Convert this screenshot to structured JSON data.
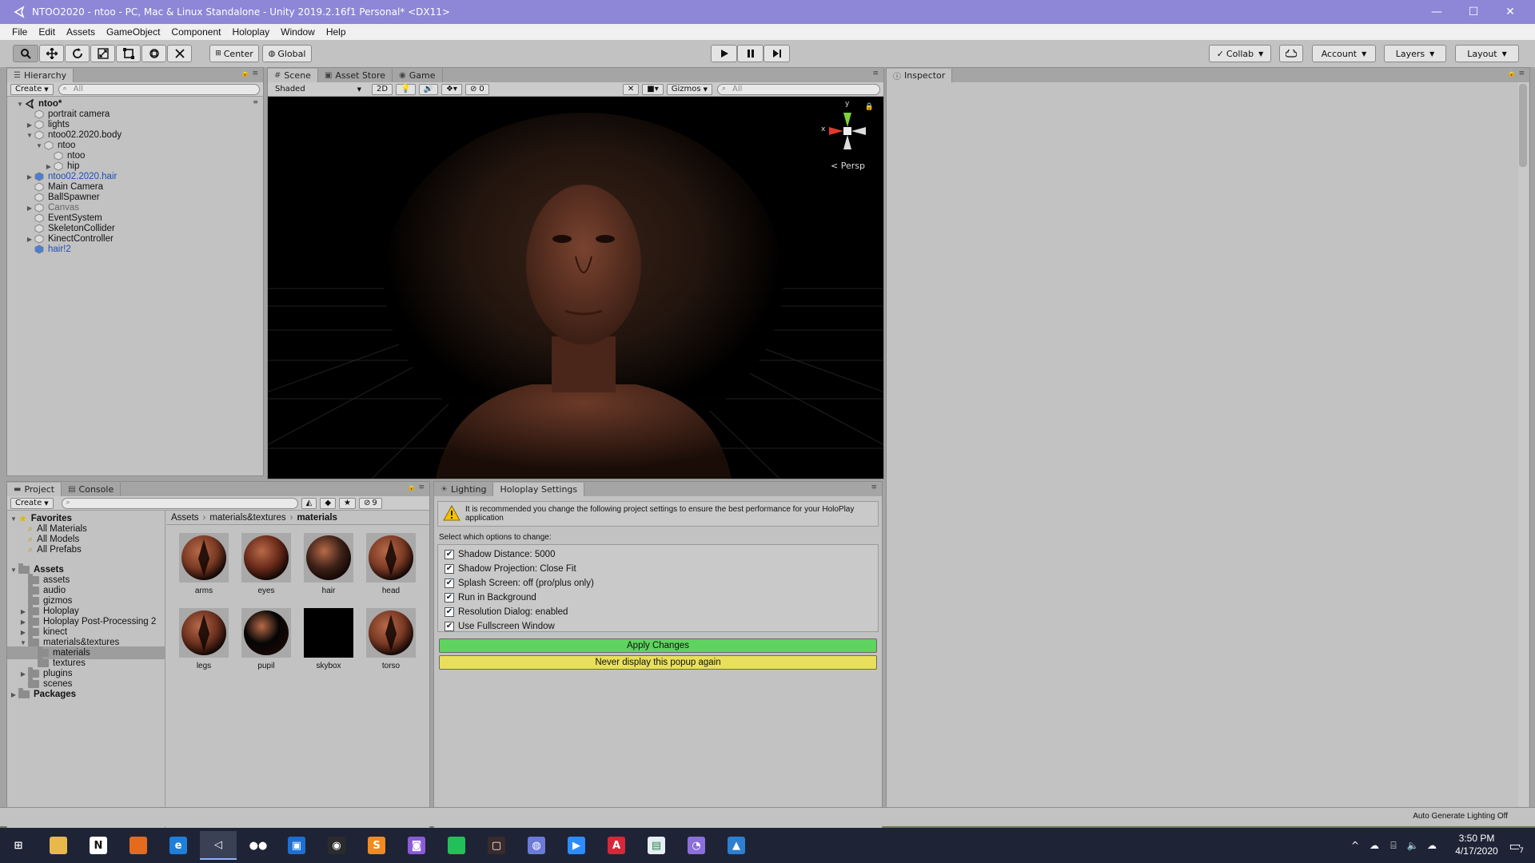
{
  "window": {
    "title": "NTOO2020 - ntoo - PC, Mac & Linux Standalone - Unity 2019.2.16f1 Personal* <DX11>",
    "controls": [
      "—",
      "☐",
      "✕"
    ]
  },
  "menu": [
    "File",
    "Edit",
    "Assets",
    "GameObject",
    "Component",
    "Holoplay",
    "Window",
    "Help"
  ],
  "toolbar": {
    "pivot_label": "Center",
    "space_label": "Global",
    "collab_label": "Collab",
    "account_label": "Account",
    "layers_label": "Layers",
    "layout_label": "Layout"
  },
  "hierarchy": {
    "tab_label": "Hierarchy",
    "create_label": "Create",
    "search_placeholder": "All",
    "items": [
      {
        "label": "ntoo*",
        "depth": 0,
        "arrow": "open",
        "style": "bold",
        "icon": "unity-scene-icon"
      },
      {
        "label": "portrait camera",
        "depth": 1,
        "arrow": "none",
        "style": "normal",
        "icon": "gameobject-icon"
      },
      {
        "label": "lights",
        "depth": 1,
        "arrow": "closed",
        "style": "normal",
        "icon": "gameobject-icon"
      },
      {
        "label": "ntoo02.2020.body",
        "depth": 1,
        "arrow": "open",
        "style": "normal",
        "icon": "gameobject-icon"
      },
      {
        "label": "ntoo",
        "depth": 2,
        "arrow": "open",
        "style": "normal",
        "icon": "gameobject-icon"
      },
      {
        "label": "ntoo",
        "depth": 3,
        "arrow": "none",
        "style": "normal",
        "icon": "gameobject-icon"
      },
      {
        "label": "hip",
        "depth": 3,
        "arrow": "closed",
        "style": "normal",
        "icon": "gameobject-icon"
      },
      {
        "label": "ntoo02.2020.hair",
        "depth": 1,
        "arrow": "closed",
        "style": "blue",
        "icon": "prefab-icon"
      },
      {
        "label": "Main Camera",
        "depth": 1,
        "arrow": "none",
        "style": "normal",
        "icon": "gameobject-icon"
      },
      {
        "label": "BallSpawner",
        "depth": 1,
        "arrow": "none",
        "style": "normal",
        "icon": "gameobject-icon"
      },
      {
        "label": "Canvas",
        "depth": 1,
        "arrow": "closed",
        "style": "dim",
        "icon": "gameobject-icon"
      },
      {
        "label": "EventSystem",
        "depth": 1,
        "arrow": "none",
        "style": "normal",
        "icon": "gameobject-icon"
      },
      {
        "label": "SkeletonCollider",
        "depth": 1,
        "arrow": "none",
        "style": "normal",
        "icon": "gameobject-icon"
      },
      {
        "label": "KinectController",
        "depth": 1,
        "arrow": "closed",
        "style": "normal",
        "icon": "gameobject-icon"
      },
      {
        "label": "hair!2",
        "depth": 1,
        "arrow": "none",
        "style": "blue",
        "icon": "prefab-icon"
      }
    ]
  },
  "scene": {
    "tabs": [
      "Scene",
      "Asset Store",
      "Game"
    ],
    "shading_mode": "Shaded",
    "mode_2d_label": "2D",
    "hidden_count": "0",
    "gizmos_label": "Gizmos",
    "search_placeholder": "All",
    "persp_label": "Persp",
    "axis_x": "x",
    "axis_y": "y"
  },
  "inspector": {
    "tab_label": "Inspector"
  },
  "project": {
    "tabs": [
      "Project",
      "Console"
    ],
    "create_label": "Create",
    "hidden_count": "9",
    "favorites_label": "Favorites",
    "favorites": [
      "All Materials",
      "All Models",
      "All Prefabs"
    ],
    "assets_label": "Assets",
    "folders": [
      {
        "label": "assets",
        "arrow": "none",
        "depth": 1
      },
      {
        "label": "audio",
        "arrow": "none",
        "depth": 1
      },
      {
        "label": "gizmos",
        "arrow": "none",
        "depth": 1
      },
      {
        "label": "Holoplay",
        "arrow": "closed",
        "depth": 1
      },
      {
        "label": "Holoplay Post-Processing 2",
        "arrow": "closed",
        "depth": 1
      },
      {
        "label": "kinect",
        "arrow": "closed",
        "depth": 1
      },
      {
        "label": "materials&textures",
        "arrow": "open",
        "depth": 1
      },
      {
        "label": "materials",
        "arrow": "none",
        "depth": 2,
        "selected": true
      },
      {
        "label": "textures",
        "arrow": "none",
        "depth": 2
      },
      {
        "label": "plugins",
        "arrow": "closed",
        "depth": 1
      },
      {
        "label": "scenes",
        "arrow": "none",
        "depth": 1
      }
    ],
    "packages_label": "Packages",
    "breadcrumb": [
      "Assets",
      "materials&textures",
      "materials"
    ],
    "assets": [
      {
        "label": "arms",
        "color": "#7a3a24"
      },
      {
        "label": "eyes",
        "color": "#6a2a1a"
      },
      {
        "label": "hair",
        "color": "#3e2218"
      },
      {
        "label": "head",
        "color": "#7d3b25"
      },
      {
        "label": "legs",
        "color": "#6e3220"
      },
      {
        "label": "pupil",
        "color": "#050505"
      },
      {
        "label": "skybox",
        "color": "#000000"
      },
      {
        "label": "torso",
        "color": "#7a3a24"
      }
    ]
  },
  "holoplay": {
    "tabs": [
      "Lighting",
      "Holoplay Settings"
    ],
    "warning_text": "It is recommended you change the following project settings to ensure the best performance for your HoloPlay application",
    "select_label": "Select which options to change:",
    "options": [
      "Shadow Distance: 5000",
      "Shadow Projection: Close Fit",
      "Splash Screen: off (pro/plus only)",
      "Run in Background",
      "Resolution Dialog: enabled",
      "Use Fullscreen Window"
    ],
    "apply_label": "Apply Changes",
    "never_label": "Never display this popup again",
    "apply_color": "#5fd35f",
    "never_color": "#e8e05a"
  },
  "status": {
    "lighting_text": "Auto Generate Lighting Off"
  },
  "taskbar": {
    "time": "3:50 PM",
    "date": "4/17/2020",
    "notification_count": "7",
    "apps": [
      {
        "name": "windows-start-icon",
        "glyph": "⊞",
        "color": "#1e2436"
      },
      {
        "name": "file-explorer-icon",
        "glyph": "",
        "color": "#e8b84a"
      },
      {
        "name": "notion-icon",
        "glyph": "N",
        "color": "#ffffff"
      },
      {
        "name": "firefox-icon",
        "glyph": "",
        "color": "#e66a1e"
      },
      {
        "name": "edge-icon",
        "glyph": "e",
        "color": "#1f7fd8"
      },
      {
        "name": "unity-icon",
        "glyph": "◁",
        "color": "#3a4155"
      },
      {
        "name": "media-icon",
        "glyph": "●●",
        "color": "#1e2436"
      },
      {
        "name": "store-icon",
        "glyph": "▣",
        "color": "#1e6fd0"
      },
      {
        "name": "obs-icon",
        "glyph": "◉",
        "color": "#2b2b2b"
      },
      {
        "name": "sublime-icon",
        "glyph": "S",
        "color": "#f28a1e"
      },
      {
        "name": "twitch-icon",
        "glyph": "◙",
        "color": "#8c5ad8"
      },
      {
        "name": "pycharm-icon",
        "glyph": "",
        "color": "#21c05a"
      },
      {
        "name": "xd-icon",
        "glyph": "▢",
        "color": "#3a2a2a"
      },
      {
        "name": "discord-icon",
        "glyph": "◍",
        "color": "#6a7bd6"
      },
      {
        "name": "zoom-icon",
        "glyph": "▶",
        "color": "#2d8cff"
      },
      {
        "name": "adobe-icon",
        "glyph": "A",
        "color": "#d8263a"
      },
      {
        "name": "sheets-icon",
        "glyph": "▤",
        "color": "#e7eef5"
      },
      {
        "name": "browser-icon",
        "glyph": "◔",
        "color": "#8c6fd8"
      },
      {
        "name": "photos-icon",
        "glyph": "▲",
        "color": "#2d7fd0"
      }
    ]
  }
}
